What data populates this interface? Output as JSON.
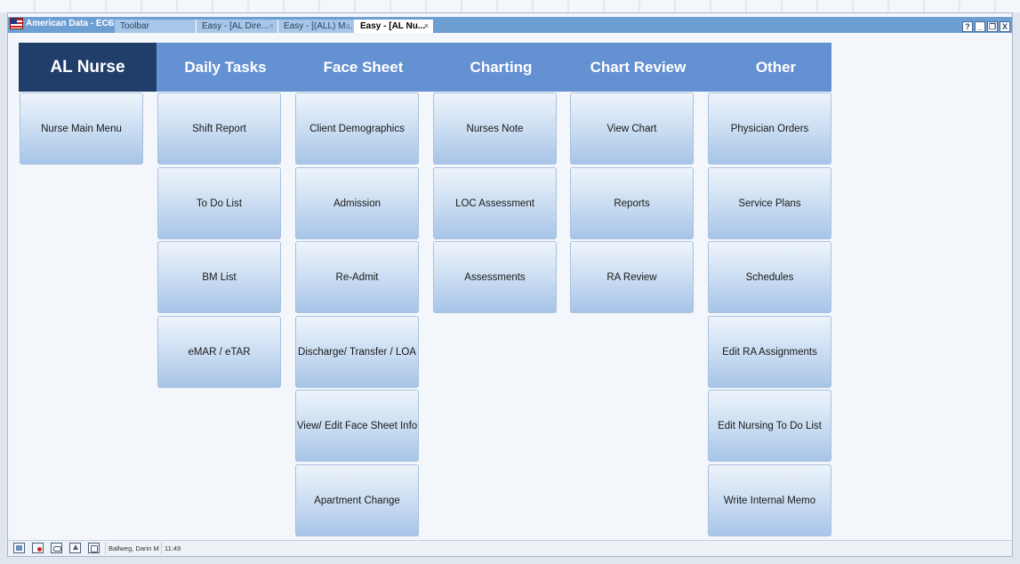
{
  "window": {
    "app_title": "American Data - ECS",
    "tabs": [
      {
        "label": "Toolbar",
        "closable": false,
        "active": false
      },
      {
        "label": "Easy - [AL Dire...",
        "closable": true,
        "active": false
      },
      {
        "label": "Easy - [(ALL) M...",
        "closable": true,
        "active": false
      },
      {
        "label": "Easy - [AL Nu...",
        "closable": true,
        "active": true
      }
    ],
    "controls": {
      "help": "?",
      "minimize": "_",
      "restore": "❐",
      "close": "X"
    }
  },
  "modules": [
    {
      "header": "AL Nurse",
      "active": true,
      "buttons": [
        "Nurse Main Menu"
      ]
    },
    {
      "header": "Daily Tasks",
      "active": false,
      "buttons": [
        "Shift Report",
        "To Do List",
        "BM List",
        "eMAR / eTAR"
      ]
    },
    {
      "header": "Face Sheet",
      "active": false,
      "buttons": [
        "Client Demographics",
        "Admission",
        "Re-Admit",
        "Discharge/ Transfer / LOA",
        "View/ Edit Face Sheet Info",
        "Apartment Change"
      ]
    },
    {
      "header": "Charting",
      "active": false,
      "buttons": [
        "Nurses Note",
        "LOC Assessment",
        "Assessments"
      ]
    },
    {
      "header": "Chart Review",
      "active": false,
      "buttons": [
        "View Chart",
        "Reports",
        "RA Review"
      ]
    },
    {
      "header": "Other",
      "active": false,
      "buttons": [
        "Physician Orders",
        "Service Plans",
        "Schedules",
        "Edit RA Assignments",
        "Edit Nursing To Do List",
        "Write Internal Memo"
      ]
    }
  ],
  "statusbar": {
    "icons": [
      "toolbar-icon",
      "alert-icon",
      "mail-icon",
      "bell-icon",
      "window-icon"
    ],
    "user": "Ballweg, Darin M",
    "time": "11:49"
  },
  "colors": {
    "titlebar": "#6e9fd3",
    "module_header": "#6491d1",
    "module_header_active": "#213e6b",
    "button_gradient_top": "#eef4fb",
    "button_gradient_bottom": "#a7c4e8"
  }
}
